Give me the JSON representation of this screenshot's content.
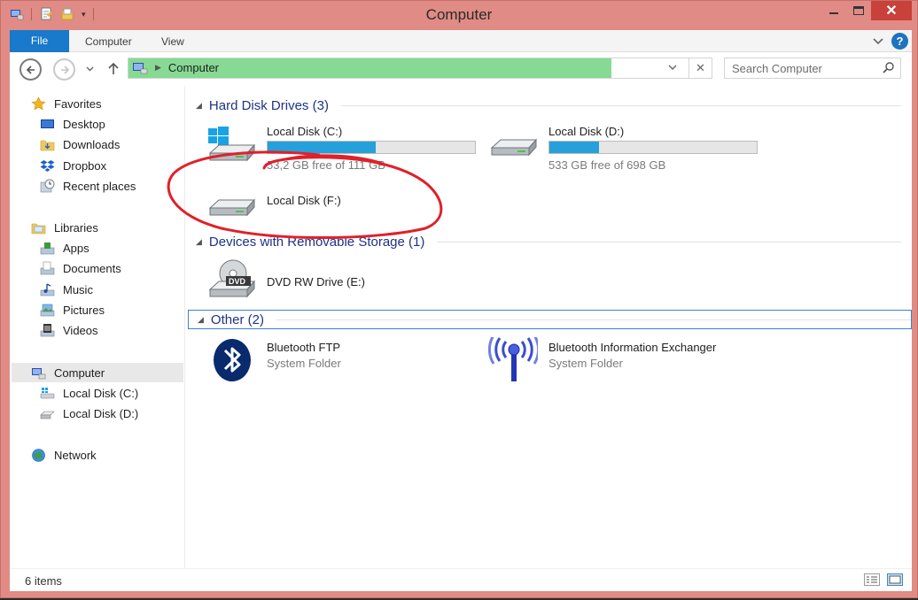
{
  "window": {
    "title": "Computer",
    "close_glyph": "✕"
  },
  "ribbon": {
    "tabs": [
      {
        "label": "File"
      },
      {
        "label": "Computer"
      },
      {
        "label": "View"
      }
    ],
    "help_glyph": "?"
  },
  "address": {
    "location": "Computer",
    "search_placeholder": "Search Computer",
    "clear_glyph": "✕"
  },
  "sidebar": {
    "favorites": {
      "label": "Favorites",
      "items": [
        {
          "label": "Desktop"
        },
        {
          "label": "Downloads"
        },
        {
          "label": "Dropbox"
        },
        {
          "label": "Recent places"
        }
      ]
    },
    "libraries": {
      "label": "Libraries",
      "items": [
        {
          "label": "Apps"
        },
        {
          "label": "Documents"
        },
        {
          "label": "Music"
        },
        {
          "label": "Pictures"
        },
        {
          "label": "Videos"
        }
      ]
    },
    "computer": {
      "label": "Computer",
      "items": [
        {
          "label": "Local Disk (C:)"
        },
        {
          "label": "Local Disk (D:)"
        }
      ]
    },
    "network": {
      "label": "Network"
    }
  },
  "groups": {
    "hard_disks": {
      "label": "Hard Disk Drives (3)",
      "drives": [
        {
          "name": "Local Disk (C:)",
          "free": "53,2 GB free of 111 GB",
          "used_fraction": 0.52
        },
        {
          "name": "Local Disk (D:)",
          "free": "533 GB free of 698 GB",
          "used_fraction": 0.24
        },
        {
          "name": "Local Disk (F:)"
        }
      ]
    },
    "removable": {
      "label": "Devices with Removable Storage (1)",
      "drives": [
        {
          "name": "DVD RW Drive (E:)",
          "icon_label": "DVD"
        }
      ]
    },
    "other": {
      "label": "Other (2)",
      "items": [
        {
          "name": "Bluetooth FTP",
          "type": "System Folder"
        },
        {
          "name": "Bluetooth Information Exchanger",
          "type": "System Folder"
        }
      ]
    }
  },
  "status": {
    "item_count": "6 items"
  },
  "colors": {
    "window_frame": "#e08b85",
    "accent": "#1979ca",
    "address_progress": "#86da94",
    "disk_bar": "#26a0da",
    "annotation": "#e0202a"
  }
}
